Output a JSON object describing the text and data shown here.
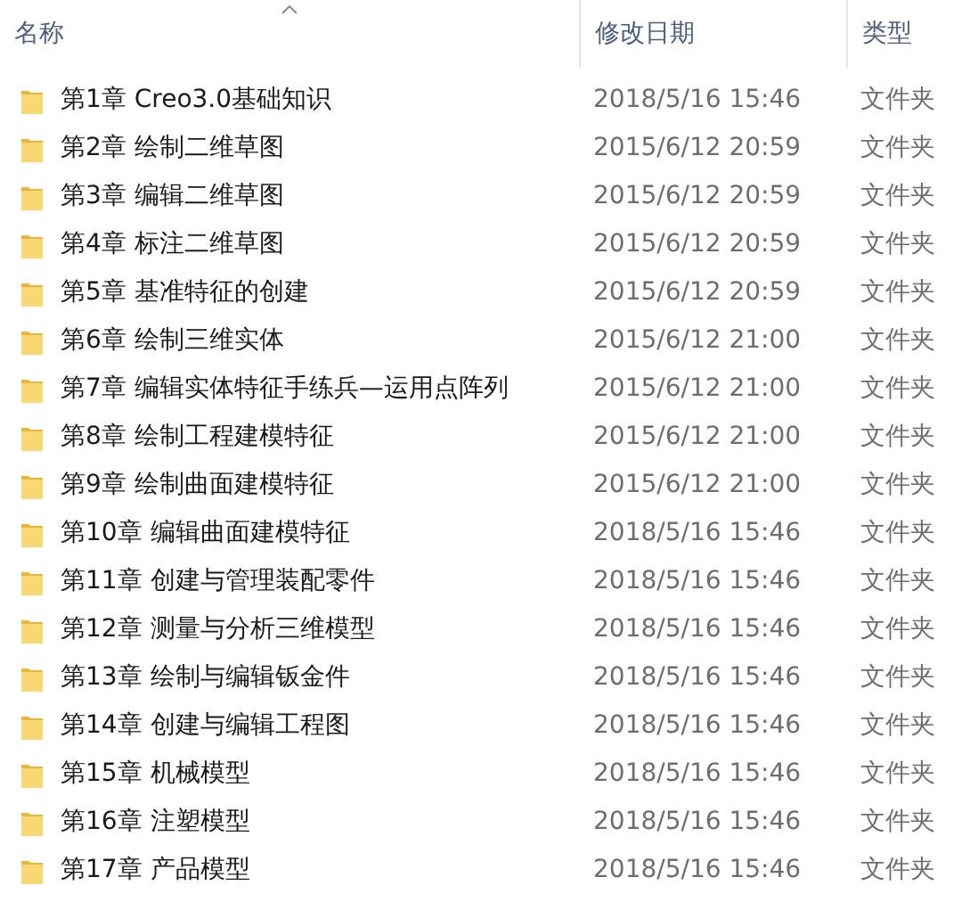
{
  "columns": [
    {
      "label": "名称",
      "sorted": true
    },
    {
      "label": "修改日期",
      "sorted": false
    },
    {
      "label": "类型",
      "sorted": false
    }
  ],
  "rows": [
    {
      "name": "第1章 Creo3.0基础知识",
      "modified": "2018/5/16 15:46",
      "type": "文件夹"
    },
    {
      "name": "第2章 绘制二维草图",
      "modified": "2015/6/12 20:59",
      "type": "文件夹"
    },
    {
      "name": "第3章 编辑二维草图",
      "modified": "2015/6/12 20:59",
      "type": "文件夹"
    },
    {
      "name": "第4章 标注二维草图",
      "modified": "2015/6/12 20:59",
      "type": "文件夹"
    },
    {
      "name": "第5章 基准特征的创建",
      "modified": "2015/6/12 20:59",
      "type": "文件夹"
    },
    {
      "name": "第6章 绘制三维实体",
      "modified": "2015/6/12 21:00",
      "type": "文件夹"
    },
    {
      "name": "第7章 编辑实体特征手练兵—运用点阵列",
      "modified": "2015/6/12 21:00",
      "type": "文件夹"
    },
    {
      "name": "第8章 绘制工程建模特征",
      "modified": "2015/6/12 21:00",
      "type": "文件夹"
    },
    {
      "name": "第9章 绘制曲面建模特征",
      "modified": "2015/6/12 21:00",
      "type": "文件夹"
    },
    {
      "name": "第10章 编辑曲面建模特征",
      "modified": "2018/5/16 15:46",
      "type": "文件夹"
    },
    {
      "name": "第11章 创建与管理装配零件",
      "modified": "2018/5/16 15:46",
      "type": "文件夹"
    },
    {
      "name": "第12章 测量与分析三维模型",
      "modified": "2018/5/16 15:46",
      "type": "文件夹"
    },
    {
      "name": "第13章 绘制与编辑钣金件",
      "modified": "2018/5/16 15:46",
      "type": "文件夹"
    },
    {
      "name": "第14章 创建与编辑工程图",
      "modified": "2018/5/16 15:46",
      "type": "文件夹"
    },
    {
      "name": "第15章 机械模型",
      "modified": "2018/5/16 15:46",
      "type": "文件夹"
    },
    {
      "name": "第16章 注塑模型",
      "modified": "2018/5/16 15:46",
      "type": "文件夹"
    },
    {
      "name": "第17章 产品模型",
      "modified": "2018/5/16 15:46",
      "type": "文件夹"
    }
  ]
}
